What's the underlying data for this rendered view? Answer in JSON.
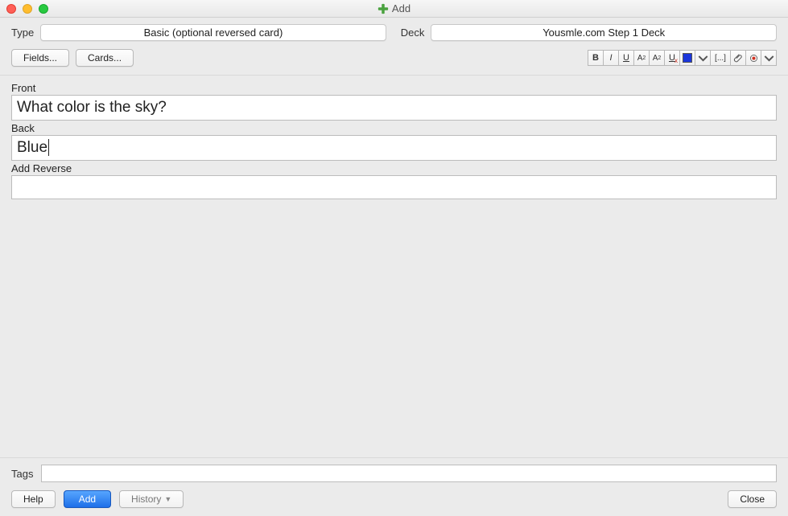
{
  "window": {
    "title": "Add"
  },
  "header": {
    "type_label": "Type",
    "type_value": "Basic (optional reversed card)",
    "deck_label": "Deck",
    "deck_value": "Yousmle.com Step 1 Deck"
  },
  "buttons": {
    "fields": "Fields...",
    "cards": "Cards...",
    "help": "Help",
    "add": "Add",
    "history": "History",
    "close": "Close"
  },
  "fields": {
    "front_label": "Front",
    "front_value": "What color is the sky?",
    "back_label": "Back",
    "back_value": "Blue",
    "add_reverse_label": "Add Reverse",
    "add_reverse_value": ""
  },
  "tags": {
    "label": "Tags",
    "value": ""
  },
  "format": {
    "bold": "B",
    "italic": "I",
    "underline": "U",
    "super": "A",
    "sub": "A",
    "clear": "U",
    "cloze": "[...]"
  }
}
